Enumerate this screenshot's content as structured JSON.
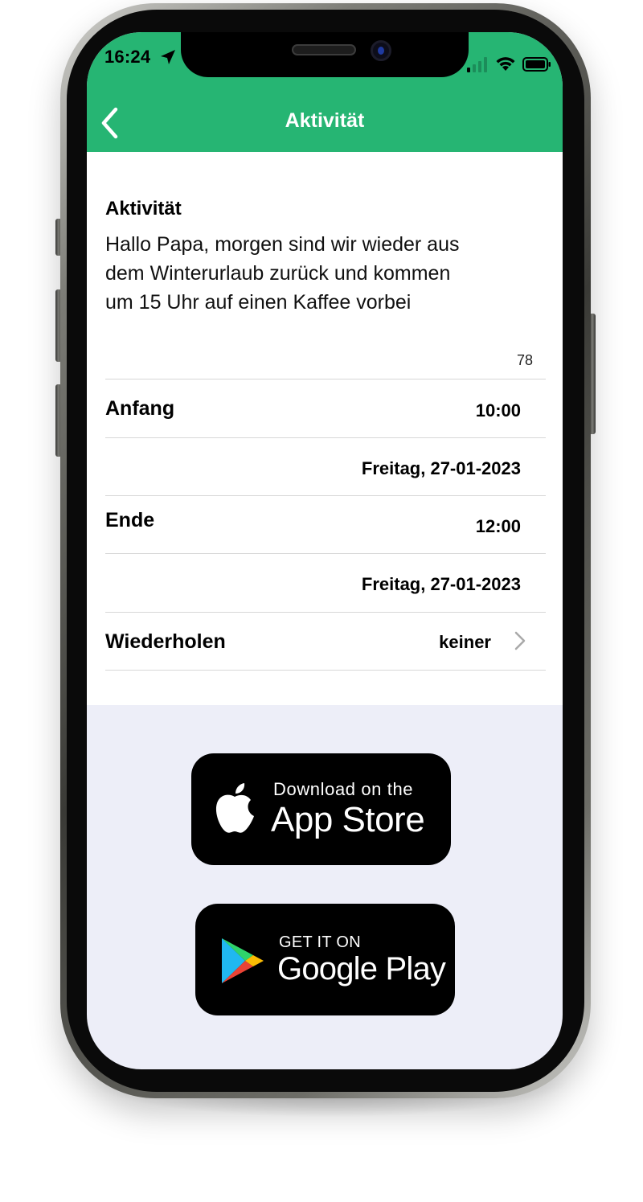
{
  "status_bar": {
    "time": "16:24",
    "icons": [
      "location-arrow-icon",
      "cellular-signal-icon",
      "wifi-icon",
      "battery-icon"
    ]
  },
  "header": {
    "title": "Aktivität",
    "back_icon": "chevron-left-icon",
    "background_color": "#26b573"
  },
  "activity": {
    "label": "Aktivität",
    "description_lines": [
      "Hallo Papa, morgen sind wir wieder aus",
      "dem Winterurlaub zurück und kommen",
      "um 15 Uhr auf einen Kaffee vorbei"
    ],
    "character_count": "78"
  },
  "start": {
    "label": "Anfang",
    "time": "10:00",
    "date": "Freitag, 27-01-2023"
  },
  "end": {
    "label": "Ende",
    "time": "12:00",
    "date": "Freitag, 27-01-2023"
  },
  "repeat": {
    "label": "Wiederholen",
    "value": "keiner",
    "icon": "chevron-right-icon"
  },
  "store_badges": {
    "app_store": {
      "small_text": "Download on the",
      "large_text": "App Store",
      "icon": "apple-logo-icon"
    },
    "google_play": {
      "small_text": "GET IT ON",
      "large_text": "Google Play",
      "icon": "google-play-logo-icon"
    }
  },
  "colors": {
    "accent_green": "#26b573",
    "lower_background": "#edeef8",
    "divider": "#d7d7d7"
  }
}
